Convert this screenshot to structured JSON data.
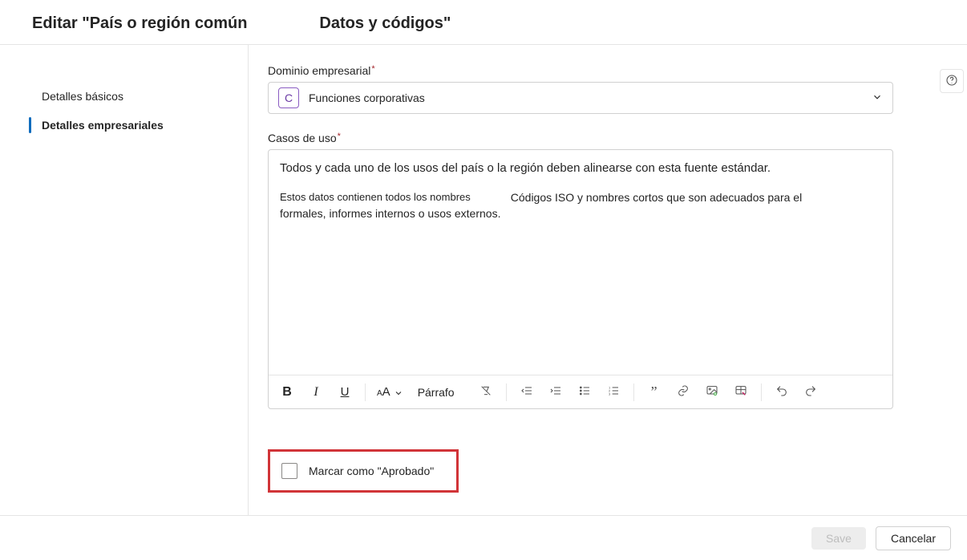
{
  "header": {
    "title_left": "Editar \"País o región común",
    "title_right": "Datos y códigos\""
  },
  "sidebar": {
    "items": [
      {
        "label": "Detalles básicos"
      },
      {
        "label": "Detalles empresariales"
      }
    ]
  },
  "main": {
    "domain_label": "Dominio empresarial",
    "domain_chip": "C",
    "domain_value": "Funciones corporativas",
    "usecases_label": "Casos de uso",
    "uc_line1": "Todos y cada uno de los usos del país o la región deben alinearse con esta fuente estándar.",
    "uc_line2a": "Estos datos contienen todos los nombres",
    "uc_line2b": "Códigos ISO y nombres cortos que son adecuados para el",
    "uc_line3": "formales, informes internos o usos externos.",
    "tb_font_label": "A",
    "tb_font_small": "A",
    "tb_style_label": "Párrafo",
    "endorse_label": "Marcar como \"Aprobado\""
  },
  "footer": {
    "save_label": "Save",
    "cancel_label": "Cancelar"
  }
}
